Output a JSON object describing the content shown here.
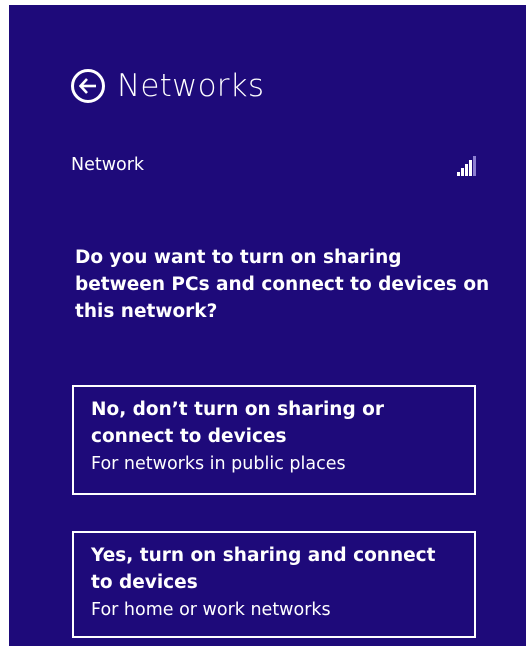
{
  "header": {
    "back_icon": "back-arrow-circle-icon",
    "title": "Networks"
  },
  "network": {
    "name": "Network",
    "signal_icon": "wifi-signal-bars-icon",
    "signal_level": 0.8
  },
  "prompt": {
    "question": "Do you want to turn on sharing between PCs and connect to devices on this network?"
  },
  "options": {
    "no": {
      "title": "No, don’t turn on sharing or connect to devices",
      "description": "For networks in public places"
    },
    "yes": {
      "title": "Yes, turn on sharing and connect to devices",
      "description": "For home or work networks"
    }
  },
  "colors": {
    "background": "#1e0a7a",
    "text": "#ffffff"
  }
}
